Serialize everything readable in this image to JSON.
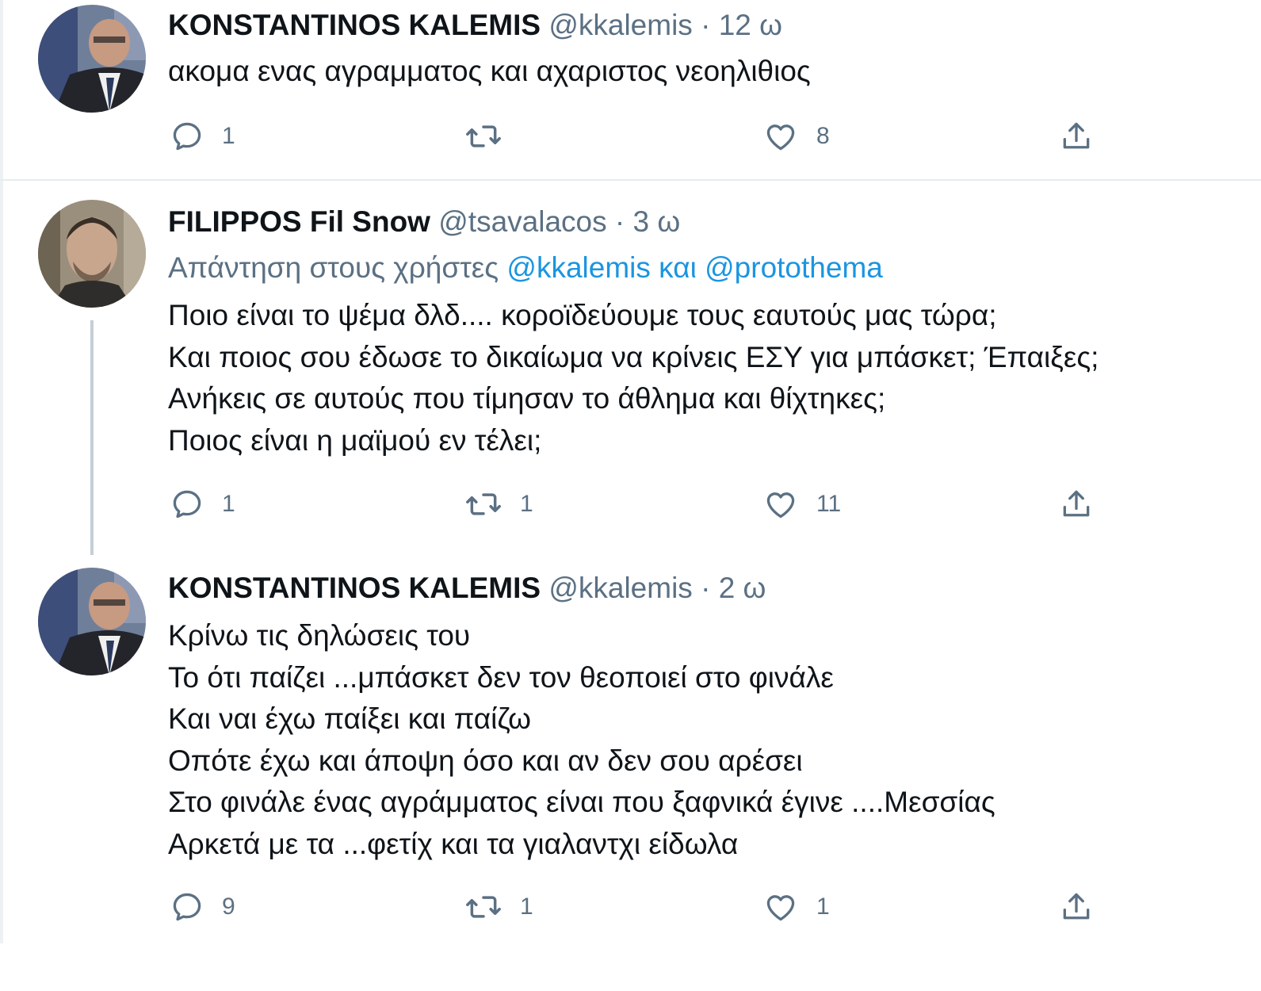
{
  "tweets": [
    {
      "name": "KONSTANTINOS KALEMIS",
      "handle": "@kkalemis",
      "separator": "·",
      "time": "12 ω",
      "text_lines": [
        "ακομα ενας αγραμματος και αχαριστος νεοηλιθιος"
      ],
      "counts": {
        "reply": "1",
        "retweet": "",
        "like": "8"
      }
    },
    {
      "name": "FILIPPOS Fil Snow",
      "handle": "@tsavalacos",
      "separator": "·",
      "time": "3 ω",
      "reply_to": {
        "prefix": "Απάντηση στους χρήστες",
        "users": "@kkalemis και @protothema"
      },
      "text_lines": [
        "Ποιο είναι το ψέμα δλδ.... κοροϊδεύουμε τους εαυτούς μας τώρα;",
        "Και ποιος σου έδωσε το δικαίωμα να κρίνεις ΕΣΥ για μπάσκετ; Έπαιξες;",
        "Ανήκεις σε αυτούς που τίμησαν το άθλημα και θίχτηκες;",
        "Ποιος είναι η μαϊμού εν τέλει;"
      ],
      "counts": {
        "reply": "1",
        "retweet": "1",
        "like": "11"
      }
    },
    {
      "name": "KONSTANTINOS KALEMIS",
      "handle": "@kkalemis",
      "separator": "·",
      "time": "2 ω",
      "text_lines": [
        "Κρίνω τις δηλώσεις του",
        "Το ότι παίζει ...μπάσκετ δεν τον θεοποιεί στο φινάλε",
        "Και ναι έχω παίξει και παίζω",
        "Οπότε έχω και άποψη όσο και αν δεν σου αρέσει",
        "Στο φινάλε ένας αγράμματος είναι που ξαφνικά έγινε ....Μεσσίας",
        "Αρκετά με τα ...φετίχ και τα γιαλαντχι είδωλα"
      ],
      "counts": {
        "reply": "9",
        "retweet": "1",
        "like": "1"
      }
    }
  ],
  "icons": {
    "reply": "reply-icon",
    "retweet": "retweet-icon",
    "like": "like-icon",
    "share": "share-icon"
  },
  "colors": {
    "text": "#0f1419",
    "secondary": "#5b7083",
    "link": "#1b95e0",
    "divider": "#e6ecf0",
    "thread_line": "#c4cfd6"
  }
}
